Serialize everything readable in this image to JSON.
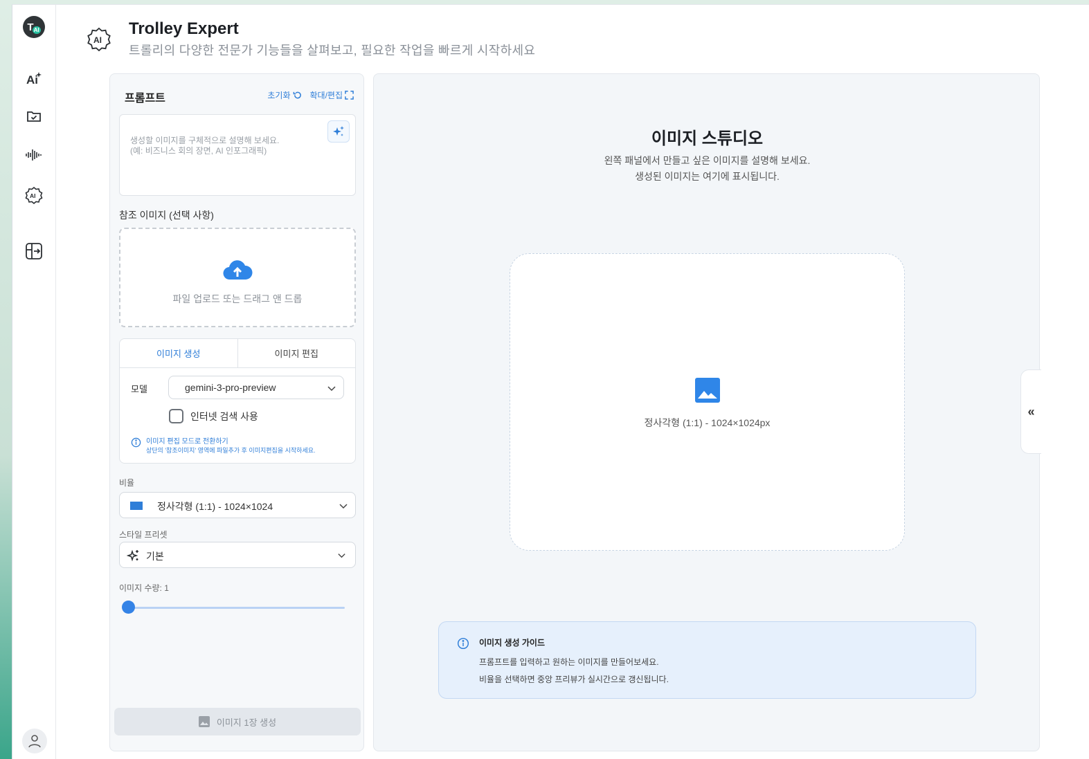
{
  "app": {
    "title": "Trolley Expert",
    "subtitle": "트롤리의 다양한 전문가 기능들을 살펴보고, 필요한 작업을 빠르게 시작하세요",
    "logo_text": "T",
    "logo_badge": "AI"
  },
  "rail": {
    "items": [
      {
        "icon": "ai-sparkle-icon",
        "label": "AI"
      },
      {
        "icon": "folder-check-icon"
      },
      {
        "icon": "audio-wave-icon"
      },
      {
        "icon": "ai-badge-icon"
      },
      {
        "icon": "panel-enter-icon"
      }
    ],
    "avatar_icon": "user-icon"
  },
  "prompt_panel": {
    "title": "프롬프트",
    "reset_label": "초기화",
    "expand_label": "확대/편집",
    "placeholder_line1": "생성할 이미지를 구체적으로 설명해 보세요.",
    "placeholder_line2": "(예: 비즈니스 회의 장면, AI 인포그래픽)",
    "reference_label": "참조 이미지 (선택 사항)",
    "upload_text": "파일 업로드 또는 드래그 앤 드롭",
    "tabs": [
      {
        "label": "이미지 생성",
        "active": true
      },
      {
        "label": "이미지 편집",
        "active": false
      }
    ],
    "model_label": "모델",
    "model_value": "gemini-3-pro-preview",
    "internet_search_label": "인터넷 검색 사용",
    "internet_search_checked": false,
    "info_title": "이미지 편집 모드로 전환하기",
    "info_desc": "상단의 '참조이미지' 영역에 파일추가 후 이미지편집을 시작하세요.",
    "ratio_label": "비율",
    "ratio_value": "정사각형 (1:1) - 1024×1024",
    "style_label": "스타일 프리셋",
    "style_value": "기본",
    "count_label": "이미지 수량: 1",
    "count_value": 1,
    "count_min": 1,
    "count_max": 4,
    "generate_label": "이미지 1장 생성"
  },
  "studio": {
    "title": "이미지 스튜디오",
    "sub_line1": "왼쪽 패널에서 만들고 싶은 이미지를 설명해 보세요.",
    "sub_line2": "생성된 이미지는 여기에 표시됩니다.",
    "preview_caption": "정사각형 (1:1) - 1024×1024px",
    "guide_title": "이미지 생성 가이드",
    "guide_line1": "프롬프트를 입력하고 원하는 이미지를 만들어보세요.",
    "guide_line2": "비율을 선택하면 중앙 프리뷰가 실시간으로 갱신됩니다.",
    "collapse_label": "«"
  },
  "colors": {
    "accent": "#2f7ed8",
    "slider": "#3483e6"
  }
}
